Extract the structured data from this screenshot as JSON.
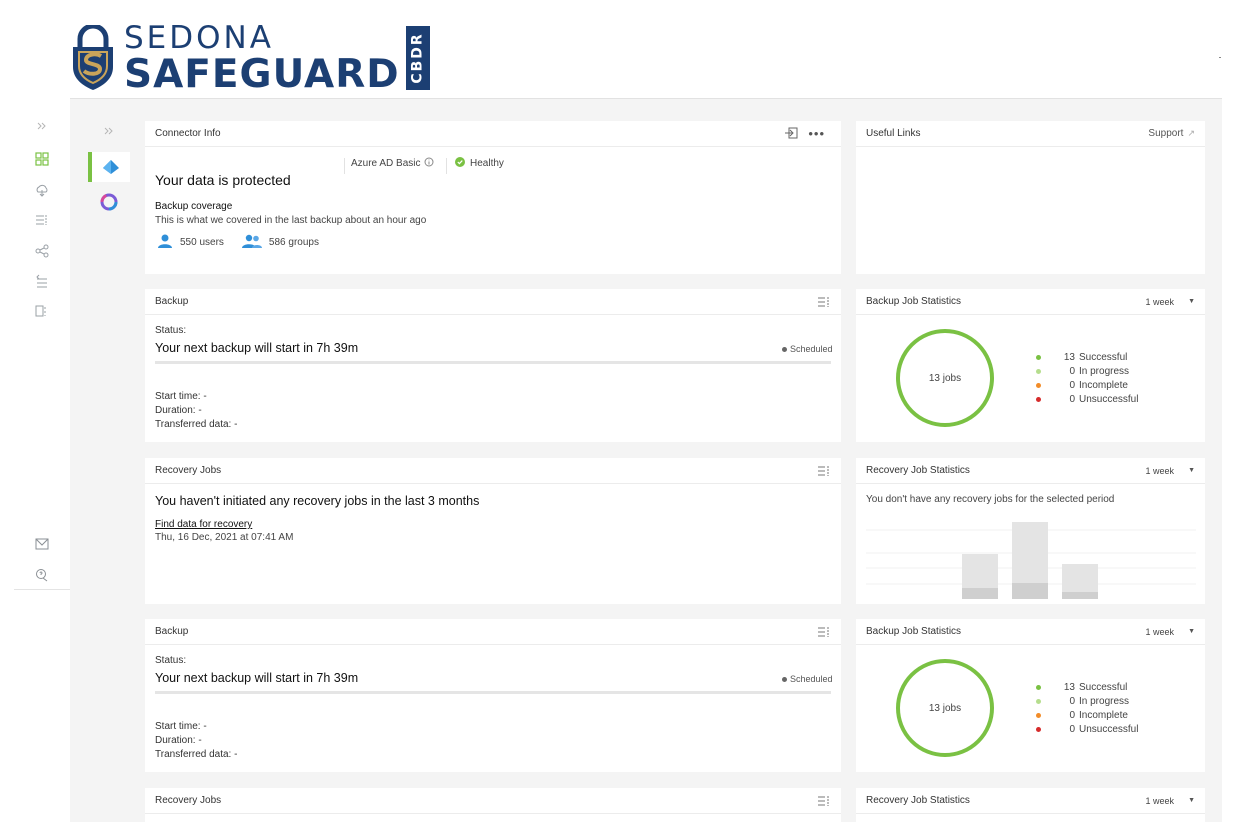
{
  "brand": {
    "line1": "SEDONA",
    "line2": "SAFEGUARD",
    "badge": "CBDR",
    "primary_color": "#1c3f73",
    "accent_color": "#c9a45a"
  },
  "rail": {
    "collapse_icon": "double-chevron-right-icon",
    "items": [
      "dashboard-icon",
      "cloud-backup-icon",
      "list-filter-icon",
      "share-icon",
      "restore-icon",
      "report-icon",
      "mail-icon",
      "support-chat-icon"
    ]
  },
  "subnav": {
    "items": [
      "azure-ad-icon",
      "microsoft-365-icon"
    ]
  },
  "connector_info": {
    "title": "Connector Info",
    "service": "Azure AD Basic",
    "status": "Healthy",
    "headline": "Your data is protected",
    "coverage_title": "Backup coverage",
    "coverage_sub": "This is what we covered in the last backup about an hour ago",
    "users": "550 users",
    "groups": "586 groups"
  },
  "useful_links": {
    "title": "Useful Links",
    "support": "Support"
  },
  "backup_1": {
    "title": "Backup",
    "status_label": "Status:",
    "headline": "Your next backup will start in 7h 39m",
    "badge": "Scheduled",
    "start_time": "Start time: -",
    "duration": "Duration: -",
    "transferred": "Transferred data: -"
  },
  "backup_stats_1": {
    "title": "Backup Job Statistics",
    "range": "1 week",
    "center": "13 jobs"
  },
  "recovery_1": {
    "title": "Recovery Jobs",
    "headline": "You haven't initiated any recovery jobs in the last 3 months",
    "link": "Find data for recovery",
    "date": "Thu, 16 Dec, 2021 at 07:41 AM"
  },
  "recovery_stats_1": {
    "title": "Recovery Job Statistics",
    "range": "1 week",
    "message": "You don't have any recovery jobs for the selected period"
  },
  "backup_2": {
    "title": "Backup",
    "status_label": "Status:",
    "headline": "Your next backup will start in 7h 39m",
    "badge": "Scheduled",
    "start_time": "Start time: -",
    "duration": "Duration: -",
    "transferred": "Transferred data: -"
  },
  "backup_stats_2": {
    "title": "Backup Job Statistics",
    "range": "1 week",
    "center": "13 jobs"
  },
  "recovery_2": {
    "title": "Recovery Jobs"
  },
  "recovery_stats_2": {
    "title": "Recovery Job Statistics",
    "range": "1 week"
  },
  "chart_data": [
    {
      "type": "pie",
      "title": "Backup Job Statistics",
      "center_label": "13 jobs",
      "categories": [
        "Successful",
        "In progress",
        "Incomplete",
        "Unsuccessful"
      ],
      "values": [
        13,
        0,
        0,
        0
      ],
      "colors": [
        "#7ac143",
        "#b5dd8d",
        "#f28c28",
        "#d62b2b"
      ],
      "legend": "right"
    },
    {
      "type": "pie",
      "title": "Backup Job Statistics",
      "center_label": "13 jobs",
      "categories": [
        "Successful",
        "In progress",
        "Incomplete",
        "Unsuccessful"
      ],
      "values": [
        13,
        0,
        0,
        0
      ],
      "colors": [
        "#7ac143",
        "#b5dd8d",
        "#f28c28",
        "#d62b2b"
      ],
      "legend": "right"
    }
  ]
}
